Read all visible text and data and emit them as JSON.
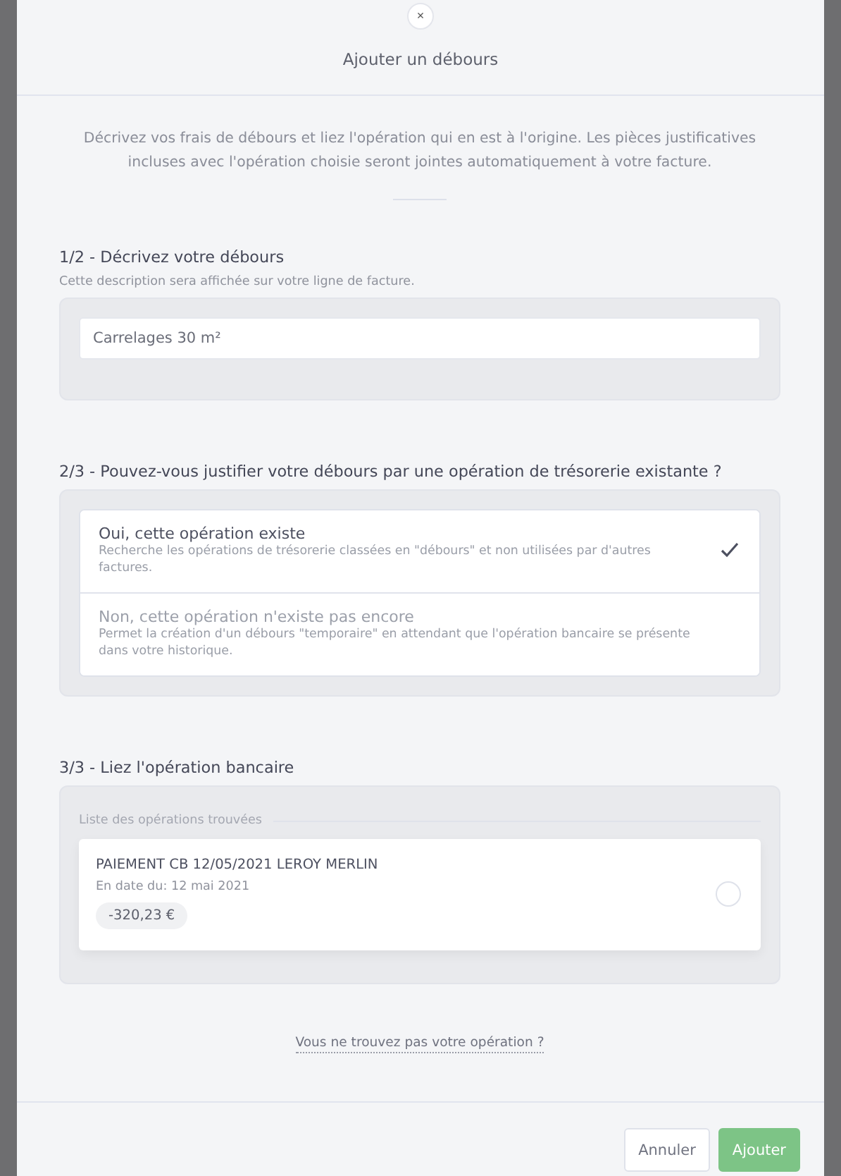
{
  "dialog": {
    "title": "Ajouter un débours",
    "close_icon": "×",
    "intro": "Décrivez vos frais de débours et liez l'opération qui en est à l'origine. Les pièces justificatives incluses avec l'opération choisie seront jointes automatiquement à votre facture."
  },
  "step1": {
    "heading": "1/2 - Décrivez votre débours",
    "hint": "Cette description sera affichée sur votre ligne de facture.",
    "value": "Carrelages 30 m²"
  },
  "step2": {
    "heading": "2/3 - Pouvez-vous justifier votre débours par une opération de trésorerie existante ?",
    "options": [
      {
        "title": "Oui, cette opération existe",
        "description": "Recherche les opérations de trésorerie classées en \"débours\" et non utilisées par d'autres factures.",
        "selected": true
      },
      {
        "title": "Non, cette opération n'existe pas encore",
        "description": "Permet la création d'un débours \"temporaire\" en attendant que l'opération bancaire se présente dans votre historique.",
        "selected": false
      }
    ]
  },
  "step3": {
    "heading": "3/3 - Liez l'opération bancaire",
    "list_label": "Liste des opérations trouvées",
    "operations": [
      {
        "label": "PAIEMENT CB 12/05/2021 LEROY MERLIN",
        "date": "En date du: 12 mai 2021",
        "amount": "-320,23 €",
        "selected": false
      }
    ]
  },
  "help_link": "Vous ne trouvez pas votre opération ?",
  "buttons": {
    "cancel": "Annuler",
    "submit": "Ajouter"
  }
}
